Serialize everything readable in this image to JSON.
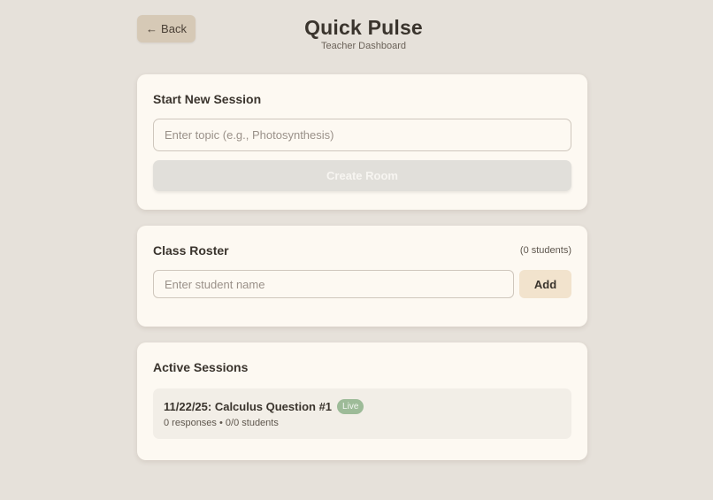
{
  "header": {
    "back_label": "Back",
    "title": "Quick Pulse",
    "subtitle": "Teacher Dashboard"
  },
  "new_session": {
    "title": "Start New Session",
    "topic_value": "",
    "topic_placeholder": "Enter topic (e.g., Photosynthesis)",
    "create_label": "Create Room"
  },
  "roster": {
    "title": "Class Roster",
    "count_text": "(0 students)",
    "student_value": "",
    "student_placeholder": "Enter student name",
    "add_label": "Add"
  },
  "active_sessions": {
    "title": "Active Sessions",
    "items": [
      {
        "name": "11/22/25: Calculus Question #1",
        "badge": "Live",
        "responses": "0 responses",
        "separator": "•",
        "students": "0/0 students"
      }
    ]
  },
  "colors": {
    "background": "#e6e1da",
    "card": "#fdf9f2",
    "back_button": "#d6c9b6",
    "add_button": "#f2e3cd",
    "create_button_disabled": "#e1dfda",
    "live_badge": "#9dbb98"
  },
  "icons": {
    "back": "arrow-left-icon"
  }
}
